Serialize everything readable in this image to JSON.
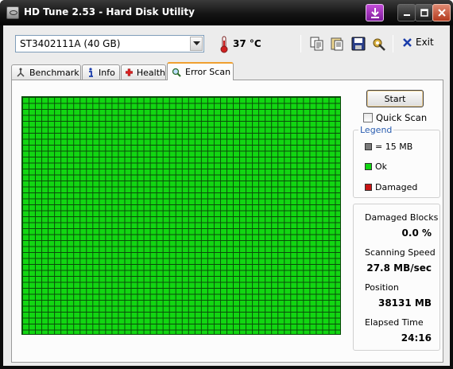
{
  "window": {
    "title": "HD Tune 2.53 - Hard Disk Utility"
  },
  "toolbar": {
    "drive": "ST3402111A (40 GB)",
    "temperature": "37 °C",
    "exit_label": "Exit"
  },
  "tabs": [
    {
      "label": "Benchmark",
      "icon": "benchmark-icon"
    },
    {
      "label": "Info",
      "icon": "info-icon"
    },
    {
      "label": "Health",
      "icon": "health-cross-icon"
    },
    {
      "label": "Error Scan",
      "icon": "magnifier-icon",
      "active": true
    }
  ],
  "scan": {
    "start_label": "Start",
    "quick_scan_label": "Quick Scan",
    "quick_scan_checked": false,
    "block_status": "all ok"
  },
  "legend": {
    "title": "Legend",
    "items": [
      {
        "label": "= 15 MB",
        "color": "#7a7a7a"
      },
      {
        "label": "Ok",
        "color": "#12d612"
      },
      {
        "label": "Damaged",
        "color": "#c81414"
      }
    ]
  },
  "stats": [
    {
      "label": "Damaged Blocks",
      "value": "0.0 %"
    },
    {
      "label": "Scanning Speed",
      "value": "27.8 MB/sec"
    },
    {
      "label": "Position",
      "value": "38131 MB"
    },
    {
      "label": "Elapsed Time",
      "value": "24:16"
    }
  ],
  "colors": {
    "ok": "#12d612",
    "accent_tab": "#f0a030",
    "legend_title": "#2a5db0"
  }
}
